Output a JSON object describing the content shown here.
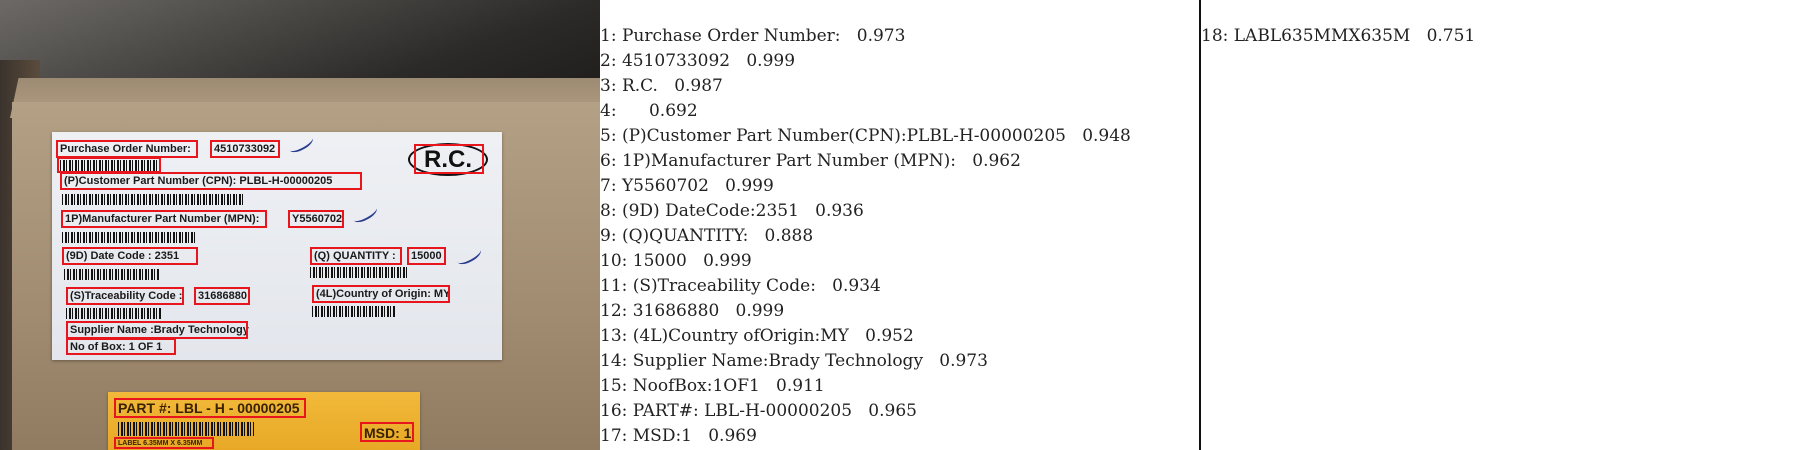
{
  "photo": {
    "alt": "shipping label photo",
    "white_label": {
      "purchase_order_label": "Purchase Order Number:",
      "purchase_order_value": "4510733092",
      "rc_mark": "R.C.",
      "cpn": "(P)Customer Part Number (CPN):  PLBL-H-00000205",
      "mpn_label": "1P)Manufacturer Part Number (MPN):",
      "mpn_value": "Y5560702",
      "date_code": "(9D) Date Code :    2351",
      "quantity_label": "(Q) QUANTITY :",
      "quantity_value": "15000",
      "traceability_label": "(S)Traceability Code :",
      "traceability_value": "31686880",
      "country": "(4L)Country of Origin: MY",
      "supplier": "Supplier Name :Brady Technology",
      "no_of_box": "No of Box:   1 OF 1"
    },
    "yellow_label": {
      "part": "PART #: LBL - H - 00000205",
      "msd": "MSD: 1",
      "small": "LABEL 6.35MM X 6.35MM"
    }
  },
  "results": [
    {
      "idx": "1:",
      "text": "Purchase Order Number:",
      "score": "0.973"
    },
    {
      "idx": "2:",
      "text": "4510733092",
      "score": "0.999"
    },
    {
      "idx": "3:",
      "text": "R.C.",
      "score": "0.987"
    },
    {
      "idx": "4:",
      "text": "",
      "score": "0.692"
    },
    {
      "idx": "5:",
      "text": "(P)Customer Part Number(CPN):PLBL-H-00000205",
      "score": "0.948"
    },
    {
      "idx": "6:",
      "text": "1P)Manufacturer Part Number (MPN):",
      "score": "0.962"
    },
    {
      "idx": "7:",
      "text": "Y5560702",
      "score": "0.999"
    },
    {
      "idx": "8:",
      "text": "(9D) DateCode:2351",
      "score": "0.936"
    },
    {
      "idx": "9:",
      "text": "(Q)QUANTITY:",
      "score": "0.888"
    },
    {
      "idx": "10:",
      "text": "15000",
      "score": "0.999"
    },
    {
      "idx": "11:",
      "text": "(S)Traceability Code:",
      "score": "0.934"
    },
    {
      "idx": "12:",
      "text": "31686880",
      "score": "0.999"
    },
    {
      "idx": "13:",
      "text": "(4L)Country ofOrigin:MY",
      "score": "0.952"
    },
    {
      "idx": "14:",
      "text": "Supplier Name:Brady Technology",
      "score": "0.973"
    },
    {
      "idx": "15:",
      "text": "NoofBox:1OF1",
      "score": "0.911"
    },
    {
      "idx": "16:",
      "text": "PART#: LBL-H-00000205",
      "score": "0.965"
    },
    {
      "idx": "17:",
      "text": "MSD:1",
      "score": "0.969"
    },
    {
      "idx": "18:",
      "text": "LABL635MMX635M",
      "score": "0.751"
    }
  ],
  "colors": {
    "detection_box": "#e8161c",
    "label_yellow": "#f2b93a",
    "label_white": "#eef0f4"
  }
}
